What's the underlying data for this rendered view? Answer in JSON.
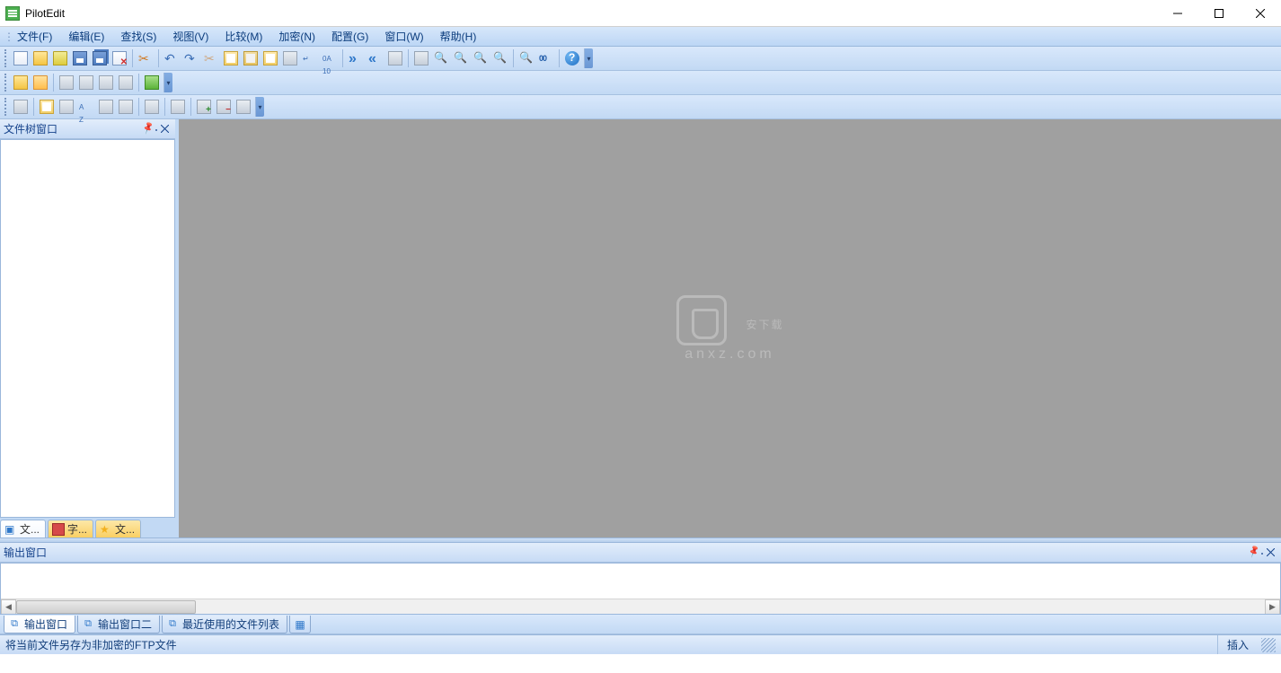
{
  "app": {
    "title": "PilotEdit"
  },
  "menu": {
    "items": [
      "文件(F)",
      "编辑(E)",
      "查找(S)",
      "视图(V)",
      "比较(M)",
      "加密(N)",
      "配置(G)",
      "窗口(W)",
      "帮助(H)"
    ]
  },
  "toolbar1": {
    "names": [
      "new-file",
      "open-file",
      "open-folder",
      "save",
      "save-all",
      "close",
      "close-all",
      "sep",
      "undo",
      "redo",
      "sep",
      "cut",
      "copy",
      "paste",
      "paste-column",
      "sep",
      "word-wrap",
      "hex-mode",
      "sep",
      "goto-start",
      "goto-end",
      "goto-line",
      "sep",
      "find",
      "find-prev",
      "find-next",
      "replace",
      "sep",
      "bookmark",
      "line-number",
      "sep",
      "help"
    ]
  },
  "toolbar2": {
    "names": [
      "ftp-open",
      "ftp-save",
      "sep",
      "compare-files",
      "compare-folders",
      "merge",
      "sync",
      "sep",
      "run-script"
    ]
  },
  "toolbar3": {
    "names": [
      "tree",
      "sep",
      "copy-path",
      "refresh",
      "sort",
      "indent",
      "outdent",
      "sep",
      "collapse-all",
      "sep",
      "expand",
      "sep",
      "add",
      "remove",
      "options"
    ]
  },
  "sidebar": {
    "title": "文件树窗口",
    "tabs": [
      {
        "label": "文...",
        "icon": "tree"
      },
      {
        "label": "字...",
        "icon": "red"
      },
      {
        "label": "文...",
        "icon": "star"
      }
    ]
  },
  "watermark": {
    "text": "安下载",
    "sub": "anxz.com"
  },
  "output": {
    "title": "输出窗口",
    "tabs": [
      {
        "label": "输出窗口",
        "active": true
      },
      {
        "label": "输出窗口二",
        "active": false
      },
      {
        "label": "最近使用的文件列表",
        "active": false
      }
    ]
  },
  "status": {
    "hint": "将当前文件另存为非加密的FTP文件",
    "mode": "插入"
  }
}
